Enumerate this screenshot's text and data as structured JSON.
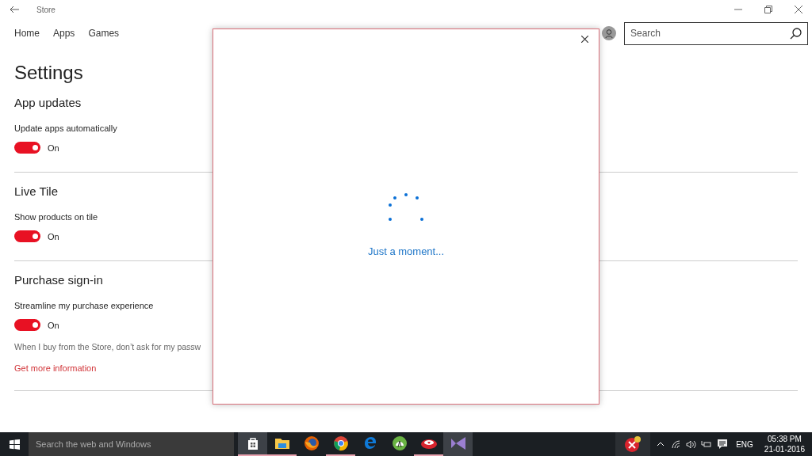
{
  "window": {
    "title": "Store"
  },
  "nav": [
    {
      "label": "Home"
    },
    {
      "label": "Apps"
    },
    {
      "label": "Games"
    }
  ],
  "search": {
    "placeholder": "Search"
  },
  "page_title": "Settings",
  "sections": [
    {
      "heading": "App updates",
      "label": "Update apps automatically",
      "on": true,
      "state_text": "On"
    },
    {
      "heading": "Live Tile",
      "label": "Show products on tile",
      "on": true,
      "state_text": "On"
    },
    {
      "heading": "Purchase sign-in",
      "label": "Streamline my purchase experience",
      "on": true,
      "state_text": "On",
      "description": "When I buy from the Store, don’t ask for my passw",
      "link": "Get more information"
    }
  ],
  "dialog": {
    "message": "Just a moment..."
  },
  "taskbar": {
    "search_placeholder": "Search the web and Windows",
    "apps": [
      {
        "kind": "store",
        "running": true,
        "selected": true
      },
      {
        "kind": "folder",
        "running": true,
        "selected": false
      },
      {
        "kind": "firefox",
        "running": false,
        "selected": false
      },
      {
        "kind": "chrome",
        "running": true,
        "selected": false
      },
      {
        "kind": "edge",
        "running": false,
        "selected": false
      },
      {
        "kind": "android",
        "running": false,
        "selected": false
      },
      {
        "kind": "red",
        "running": true,
        "selected": false
      },
      {
        "kind": "vs",
        "running": false,
        "selected": true
      }
    ],
    "language": "ENG",
    "time": "05:38 PM",
    "date": "21-01-2016"
  }
}
